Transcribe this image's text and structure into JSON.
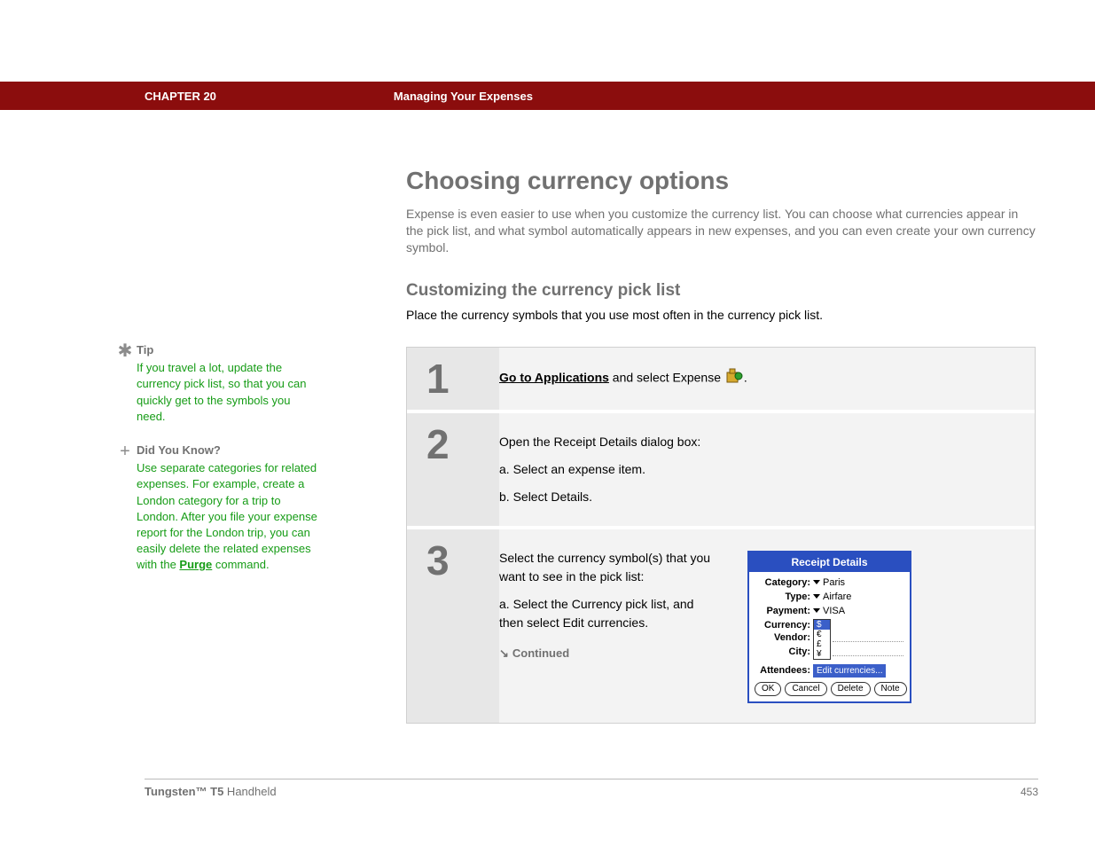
{
  "header": {
    "chapter": "CHAPTER 20",
    "title": "Managing Your Expenses"
  },
  "page": {
    "h1": "Choosing currency options",
    "intro": "Expense is even easier to use when you customize the currency list. You can choose what currencies appear in the pick list, and what symbol automatically appears in new expenses, and you can even create your own currency symbol.",
    "h2": "Customizing the currency pick list",
    "sub_intro": "Place the currency symbols that you use most often in the currency pick list."
  },
  "steps": {
    "s1": {
      "num": "1",
      "link": "Go to Applications",
      "rest": " and select Expense ",
      "period": "."
    },
    "s2": {
      "num": "2",
      "lead": "Open the Receipt Details dialog box:",
      "a": "a.  Select an expense item.",
      "b": "b.  Select Details."
    },
    "s3": {
      "num": "3",
      "lead": "Select the currency symbol(s) that you want to see in the pick list:",
      "a": "a.  Select the Currency pick list, and then select Edit currencies.",
      "continued": "Continued"
    }
  },
  "sidebar": {
    "tip": {
      "title": "Tip",
      "body": "If you travel a lot, update the currency pick list, so that you can quickly get to the symbols you need."
    },
    "dyk": {
      "title": "Did You Know?",
      "body_pre": "Use separate categories for related expenses. For example, create a London category for a trip to London. After you file your expense report for the London trip, you can easily delete the related expenses with the ",
      "link": "Purge",
      "body_post": " command."
    }
  },
  "dialog": {
    "title": "Receipt Details",
    "labels": {
      "category": "Category:",
      "type": "Type:",
      "payment": "Payment:",
      "currency": "Currency:",
      "vendor": "Vendor:",
      "city": "City:",
      "attendees": "Attendees:"
    },
    "values": {
      "category": "Paris",
      "type": "Airfare",
      "payment": "VISA",
      "c1": "$",
      "c2": "€",
      "c3": "£",
      "c4": "¥",
      "editcurr": "Edit currencies..."
    },
    "buttons": {
      "ok": "OK",
      "cancel": "Cancel",
      "del": "Delete",
      "note": "Note"
    }
  },
  "footer": {
    "product_bold": "Tungsten™ T5",
    "product_rest": " Handheld",
    "page": "453"
  }
}
